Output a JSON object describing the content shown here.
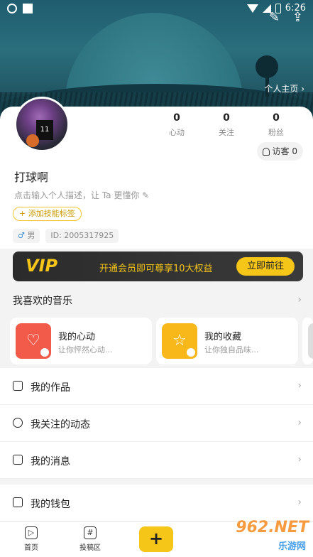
{
  "status_bar": {
    "time": "6:26"
  },
  "header": {
    "homepage_link": "个人主页 ›"
  },
  "profile": {
    "avatar_jersey": "11",
    "stats": [
      {
        "value": "0",
        "label": "心动"
      },
      {
        "value": "0",
        "label": "关注"
      },
      {
        "value": "0",
        "label": "粉丝"
      }
    ],
    "visitors_label": "访客 0",
    "nickname": "打球啊",
    "description": "点击输入个人描述，让 Ta 更懂你 ✎",
    "skill_tag": "+ 添加技能标签",
    "gender_symbol": "♂",
    "gender": "男",
    "user_id": "ID: 2005317925"
  },
  "vip": {
    "logo": "VIP",
    "text": "开通会员即可尊享10大权益",
    "button": "立即前往"
  },
  "music": {
    "section_title": "我喜欢的音乐",
    "cards": [
      {
        "title": "我的心动",
        "subtitle": "让你怦然心动...",
        "icon": "heart-pulse-icon",
        "color": "#f25a49"
      },
      {
        "title": "我的收藏",
        "subtitle": "让你独自品味...",
        "icon": "star-icon",
        "color": "#f8b81a"
      }
    ]
  },
  "menu": [
    {
      "label": "我的作品",
      "icon": "music-note-icon"
    },
    {
      "label": "我关注的动态",
      "icon": "compass-icon"
    },
    {
      "label": "我的消息",
      "icon": "envelope-icon"
    }
  ],
  "wallet": {
    "label": "我的钱包"
  },
  "tabbar": {
    "home": "首页",
    "submission": "投稿区",
    "add": "+"
  },
  "watermark": {
    "main": "962.NET",
    "sub": "乐游网"
  }
}
